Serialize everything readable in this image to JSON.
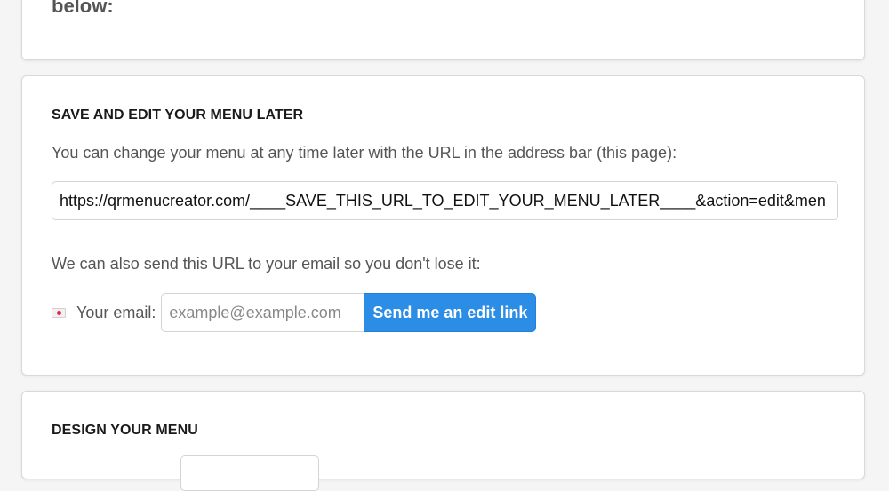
{
  "top_card": {
    "text": "below:"
  },
  "save_section": {
    "heading": "SAVE AND EDIT YOUR MENU LATER",
    "description": "You can change your menu at any time later with the URL in the address bar (this page):",
    "url_value": "https://qrmenucreator.com/____SAVE_THIS_URL_TO_EDIT_YOUR_MENU_LATER____&action=edit&men",
    "email_description": "We can also send this URL to your email so you don't lose it:",
    "email_icon": "love-letter-icon",
    "email_label": "Your email:",
    "email_placeholder": "example@example.com",
    "email_value": "",
    "send_button_label": "Send me an edit link"
  },
  "design_section": {
    "heading": "DESIGN YOUR MENU"
  },
  "colors": {
    "accent": "#2b8de6",
    "heading": "#1a1a1a",
    "text": "#555555",
    "background": "#f5f5f5"
  }
}
